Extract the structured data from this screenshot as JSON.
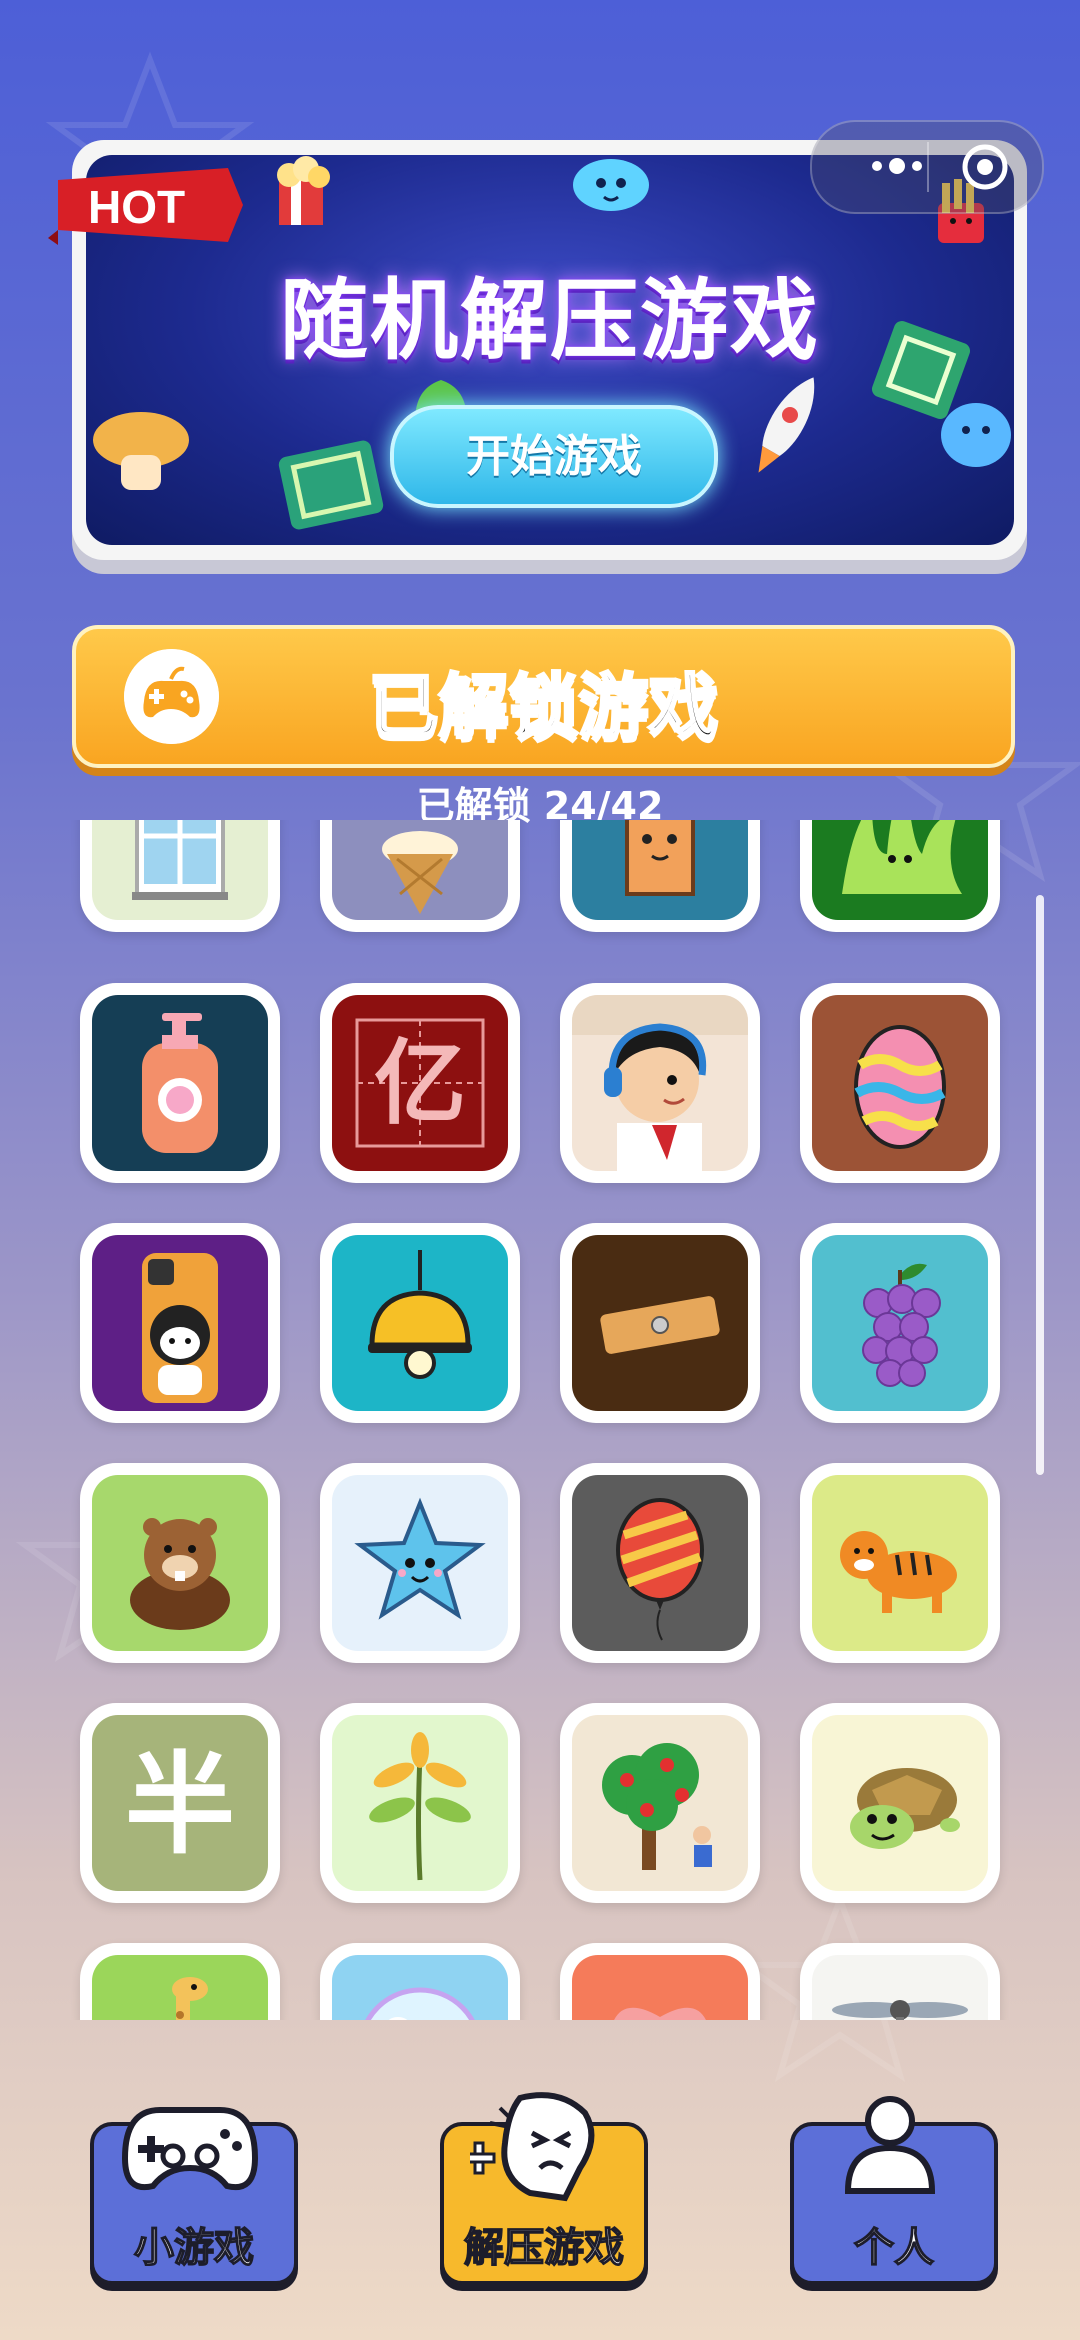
{
  "banner": {
    "hot": "HOT",
    "title": "随机解压游戏",
    "start_label": "开始游戏"
  },
  "unlocked": {
    "title": "已解锁游戏",
    "count_text": "已解锁 24/42"
  },
  "grid": {
    "tiles": [
      {
        "icon": "window-icon",
        "bg": "#e5efd2"
      },
      {
        "icon": "ice-cream-cone-icon",
        "bg": "#8d8fbe"
      },
      {
        "icon": "door-icon",
        "bg": "#2c7fa0"
      },
      {
        "icon": "grass-icon",
        "bg": "#1b7b20"
      },
      {
        "icon": "lotion-bottle-icon",
        "bg": "#153e55"
      },
      {
        "icon": "character-yi-icon",
        "bg": "#8d1010"
      },
      {
        "icon": "boy-headphones-icon",
        "bg": "#f3e4d6"
      },
      {
        "icon": "easter-egg-icon",
        "bg": "#9c5336"
      },
      {
        "icon": "phone-case-icon",
        "bg": "#5e1f86"
      },
      {
        "icon": "hanging-lamp-icon",
        "bg": "#1db5c7"
      },
      {
        "icon": "wood-plank-icon",
        "bg": "#4a2c12"
      },
      {
        "icon": "grapes-icon",
        "bg": "#52bfcf"
      },
      {
        "icon": "beaver-icon",
        "bg": "#a7d86c"
      },
      {
        "icon": "star-face-icon",
        "bg": "#e6f1fb"
      },
      {
        "icon": "balloon-icon",
        "bg": "#5c5c5c"
      },
      {
        "icon": "tiger-icon",
        "bg": "#dcea88"
      },
      {
        "icon": "character-ban-icon",
        "bg": "#a6b47a"
      },
      {
        "icon": "sprout-icon",
        "bg": "#e2f7cd"
      },
      {
        "icon": "apple-tree-icon",
        "bg": "#f2e7d4"
      },
      {
        "icon": "turtle-icon",
        "bg": "#f8f5d5"
      },
      {
        "icon": "giraffe-icon",
        "bg": "#9bd65a"
      },
      {
        "icon": "bubble-icon",
        "bg": "#8fd3f2"
      },
      {
        "icon": "heart-icon",
        "bg": "#f57b5a"
      },
      {
        "icon": "propeller-icon",
        "bg": "#f5f5f2"
      }
    ]
  },
  "nav": {
    "mini_games": "小游戏",
    "stress_games": "解压游戏",
    "profile": "个人"
  },
  "colors": {
    "nav_blue": "#5c6fd8",
    "nav_yellow": "#f7b92c",
    "unlock_orange": "#f9a521"
  }
}
